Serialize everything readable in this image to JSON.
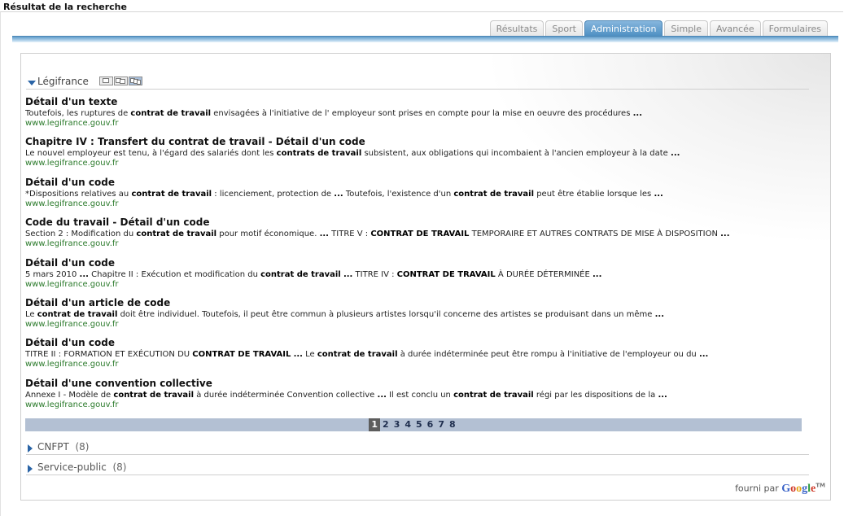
{
  "page_title": "Résultat de la recherche",
  "tabs": [
    "Résultats",
    "Sport",
    "Administration",
    "Simple",
    "Avancée",
    "Formulaires"
  ],
  "active_tab": "Administration",
  "section": {
    "name": "Légifrance"
  },
  "results": [
    {
      "title": "Détail d'un texte",
      "snippet": "Toutefois, les ruptures de <b>contrat de travail</b> envisagées à l'initiative de l' employeur sont prises en compte pour la mise en oeuvre des procédures <b>...</b>",
      "url": "www.legifrance.gouv.fr"
    },
    {
      "title": "Chapitre IV : Transfert du contrat de travail - Détail d'un code",
      "snippet": "Le nouvel employeur est tenu, à l'égard des salariés dont les <b>contrats de travail</b> subsistent, aux obligations qui incombaient à l'ancien employeur à la date <b>...</b>",
      "url": "www.legifrance.gouv.fr"
    },
    {
      "title": "Détail d'un code",
      "snippet": "*Dispositions relatives au <b>contrat de travail</b> : licenciement, protection de <b>...</b> Toutefois, l'existence d'un <b>contrat de travail</b> peut être établie lorsque les <b>...</b>",
      "url": "www.legifrance.gouv.fr"
    },
    {
      "title": "Code du travail - Détail d'un code",
      "snippet": "Section 2 : Modification du <b>contrat de travail</b> pour motif économique. <b>...</b> TITRE V : <b>CONTRAT DE TRAVAIL</b> TEMPORAIRE ET AUTRES CONTRATS DE MISE À DISPOSITION <b>...</b>",
      "url": "www.legifrance.gouv.fr"
    },
    {
      "title": "Détail d'un code",
      "snippet": "5 mars 2010 <b>...</b> Chapitre II : Exécution et modification du <b>contrat de travail</b> <b>...</b> TITRE IV : <b>CONTRAT DE TRAVAIL</b> À DURÉE DÉTERMINÉE <b>...</b>",
      "url": "www.legifrance.gouv.fr"
    },
    {
      "title": "Détail d'un article de code",
      "snippet": "Le <b>contrat de travail</b> doit être individuel. Toutefois, il peut être commun à plusieurs artistes lorsqu'il concerne des artistes se produisant dans un même <b>...</b>",
      "url": "www.legifrance.gouv.fr"
    },
    {
      "title": "Détail d'un code",
      "snippet": "TITRE II : FORMATION ET EXÉCUTION DU <b>CONTRAT DE TRAVAIL</b> <b>...</b> Le <b>contrat de travail</b> à durée indéterminée peut être rompu à l'initiative de l'employeur ou du <b>...</b>",
      "url": "www.legifrance.gouv.fr"
    },
    {
      "title": "Détail d'une convention collective",
      "snippet": "Annexe I - Modèle de <b>contrat de travail</b> à durée indéterminée Convention collective <b>...</b> Il est conclu un <b>contrat de travail</b> régi par les dispositions de la <b>...</b>",
      "url": "www.legifrance.gouv.fr"
    }
  ],
  "pagination": {
    "current": "1",
    "pages": [
      "1",
      "2",
      "3",
      "4",
      "5",
      "6",
      "7",
      "8"
    ]
  },
  "collapsed_sections": [
    {
      "name": "CNFPT",
      "count": "(8)"
    },
    {
      "name": "Service-public",
      "count": "(8)"
    }
  ],
  "footer": {
    "provided_by": "fourni par",
    "brand": "Google",
    "tm": "TM"
  }
}
